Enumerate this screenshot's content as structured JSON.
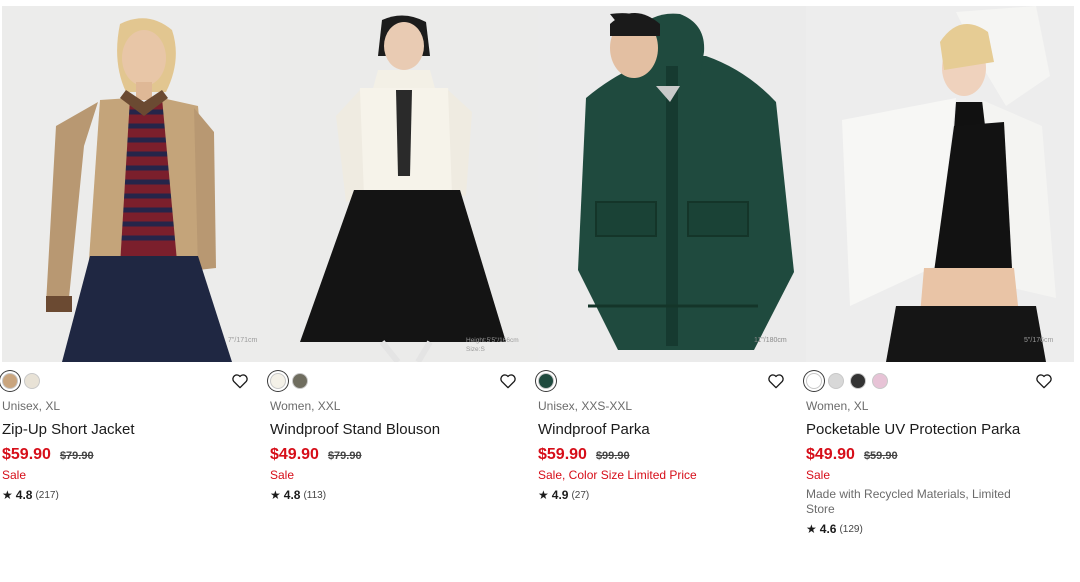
{
  "products": [
    {
      "category": "Unisex, XL",
      "name": "Zip-Up Short Jacket",
      "price": "$59.90",
      "old_price": "$79.90",
      "flag": "Sale",
      "note": "",
      "rating": "4.8",
      "reviews": "(217)",
      "swatches": [
        "#c9a57e",
        "#e8e2d6"
      ],
      "photo_caption": "7\"/171cm"
    },
    {
      "category": "Women, XXL",
      "name": "Windproof Stand Blouson",
      "price": "$49.90",
      "old_price": "$79.90",
      "flag": "Sale",
      "note": "",
      "rating": "4.8",
      "reviews": "(113)",
      "swatches": [
        "#f4f1e8",
        "#6f6d5f"
      ],
      "photo_caption": "Height:5'5\"/166cm Size:S"
    },
    {
      "category": "Unisex, XXS-XXL",
      "name": "Windproof Parka",
      "price": "$59.90",
      "old_price": "$99.90",
      "flag": "Sale, Color Size Limited Price",
      "note": "",
      "rating": "4.9",
      "reviews": "(27)",
      "swatches": [
        "#1f4a3e"
      ],
      "photo_caption": "11\"/180cm Size:L"
    },
    {
      "category": "Women, XL",
      "name": "Pocketable UV Protection Parka",
      "price": "$49.90",
      "old_price": "$59.90",
      "flag": "Sale",
      "note": "Made with Recycled Materials, Limited Store",
      "rating": "4.6",
      "reviews": "(129)",
      "swatches": [
        "#ffffff",
        "#d8d8d8",
        "#333333",
        "#e7c3d6"
      ],
      "photo_caption": "5\"/176cm"
    }
  ],
  "colors": {
    "sale_red": "#d60e19",
    "meta_gray": "#6b6b6b"
  },
  "icons": {
    "favorite": "heart-icon",
    "rating": "star-icon"
  }
}
